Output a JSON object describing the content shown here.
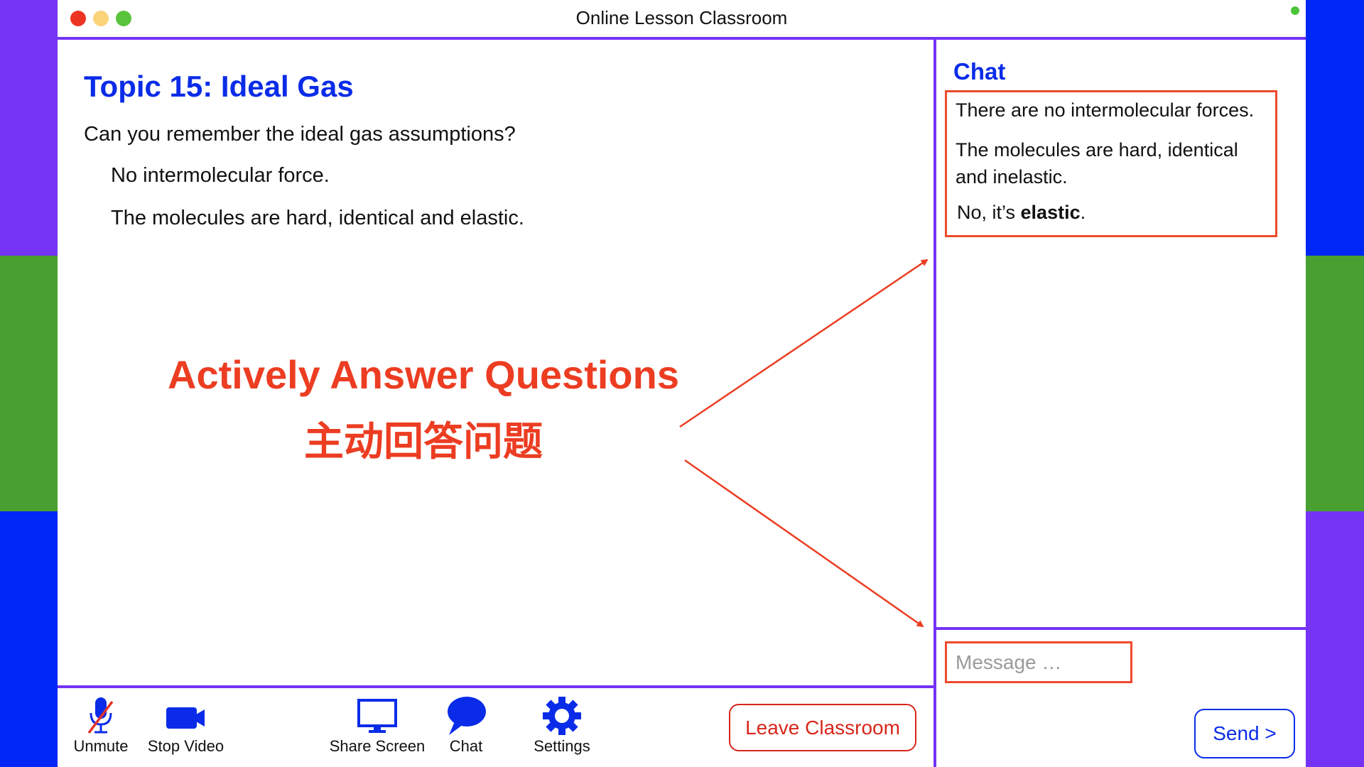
{
  "side_stripes": {
    "left": [
      "#7433F5",
      "#49A030",
      "#0026F8"
    ],
    "right": [
      "#0026F8",
      "#49A030",
      "#7433F5"
    ]
  },
  "window": {
    "title": "Online Lesson Classroom",
    "traffic_lights": [
      "#EE3524",
      "#FBD379",
      "#5AC43C"
    ],
    "status_dot_color": "#4CC33A",
    "accent_color": "#7433F5"
  },
  "lesson": {
    "topic_title": "Topic 15: Ideal Gas",
    "question": "Can you remember the ideal gas assumptions?",
    "answers": [
      "No intermolecular force.",
      "The molecules are hard, identical and elastic."
    ]
  },
  "annotation": {
    "title_en": "Actively Answer Questions",
    "title_zh": "主动回答问题",
    "color": "#EC3D22"
  },
  "chat": {
    "title": "Chat",
    "messages": [
      {
        "text": "There are no intermolecular forces."
      },
      {
        "text": "The molecules are hard, identical and inelastic."
      },
      {
        "prefix": "No, it’s ",
        "bold": "elastic",
        "suffix": "."
      }
    ],
    "input_placeholder": "Message …",
    "input_value": "",
    "send_label": "Send >"
  },
  "toolbar": {
    "items": [
      {
        "label": "Unmute",
        "icon": "microphone-muted-icon"
      },
      {
        "label": "Stop Video",
        "icon": "video-camera-icon"
      },
      {
        "label": "Share Screen",
        "icon": "monitor-icon"
      },
      {
        "label": "Chat",
        "icon": "speech-bubble-icon"
      },
      {
        "label": "Settings",
        "icon": "gear-icon"
      }
    ],
    "leave_label": "Leave Classroom",
    "icon_color": "#0A2CE8"
  }
}
